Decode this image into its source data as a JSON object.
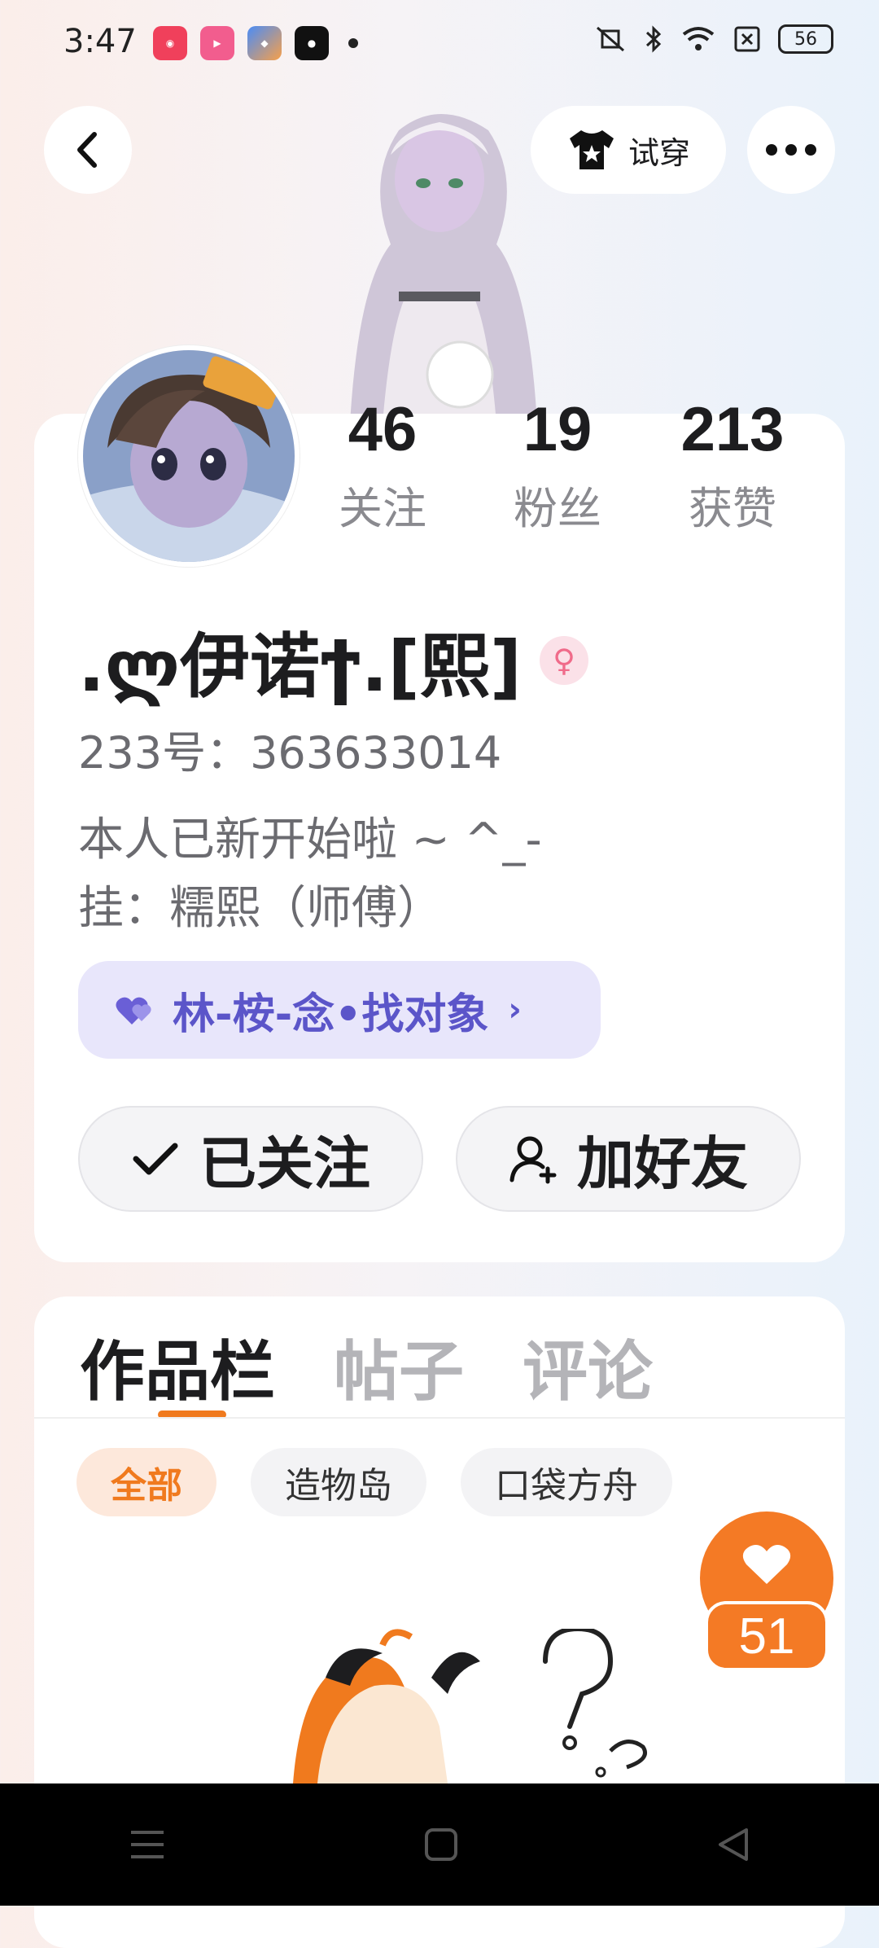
{
  "status_bar": {
    "time": "3:47",
    "battery": "56"
  },
  "header": {
    "try_on_label": "试穿"
  },
  "profile": {
    "stats": [
      {
        "value": "46",
        "label": "关注"
      },
      {
        "value": "19",
        "label": "粉丝"
      },
      {
        "value": "213",
        "label": "获赞"
      }
    ],
    "name": ".ლ伊诺ϯ.[熙]",
    "gender_symbol": "♀",
    "uid": "233号：363633014",
    "bio": [
      "本人已新开始啦 ~ ^_-",
      "挂：糯熙（师傅）"
    ],
    "couple_tag": {
      "label": "林-桉-念•找对象",
      "chevron": "›"
    },
    "follow_button": "已关注",
    "add_friend_button": "加好友"
  },
  "works": {
    "tabs": [
      "作品栏",
      "帖子",
      "评论"
    ],
    "filters": [
      "全部",
      "造物岛",
      "口袋方舟"
    ],
    "like_count": "51"
  },
  "colors": {
    "accent": "#f07a1e",
    "couple_purple": "#5b55c9",
    "gender_pink": "#f06b8a"
  }
}
